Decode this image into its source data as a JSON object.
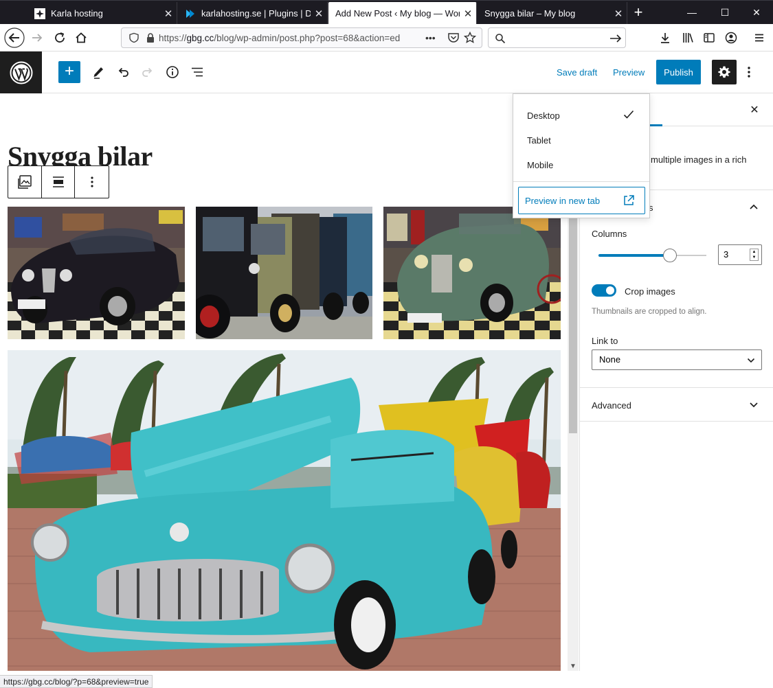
{
  "browser": {
    "tabs": [
      {
        "title": "Karla hosting",
        "active": false
      },
      {
        "title": "karlahosting.se | Plugins | Dire",
        "active": false
      },
      {
        "title": "Add New Post ‹ My blog — Word",
        "active": true
      },
      {
        "title": "Snygga bilar – My blog",
        "active": false
      }
    ],
    "url_prefix": "https://",
    "url_host": "gbg.cc",
    "url_path": "/blog/wp-admin/post.php?post=68&action=ed",
    "search_placeholder": ""
  },
  "header": {
    "save_draft": "Save draft",
    "preview": "Preview",
    "publish": "Publish"
  },
  "editor": {
    "post_title": "Snygga bilar"
  },
  "preview_menu": {
    "items": [
      "Desktop",
      "Tablet",
      "Mobile"
    ],
    "selected": "Desktop",
    "new_tab": "Preview in new tab"
  },
  "sidebar": {
    "description_fragment": "multiple images in a rich",
    "columns_label": "Columns",
    "columns_value": "3",
    "crop_label": "Crop images",
    "crop_help": "Thumbnails are cropped to align.",
    "link_to_label": "Link to",
    "link_to_value": "None",
    "advanced_label": "Advanced",
    "panel_fragment": "s"
  },
  "statusbar": {
    "text": "https://gbg.cc/blog/?p=68&preview=true"
  },
  "colors": {
    "accent": "#007cba",
    "dark": "#1e1e1e",
    "tabstrip": "#1c1b22"
  }
}
